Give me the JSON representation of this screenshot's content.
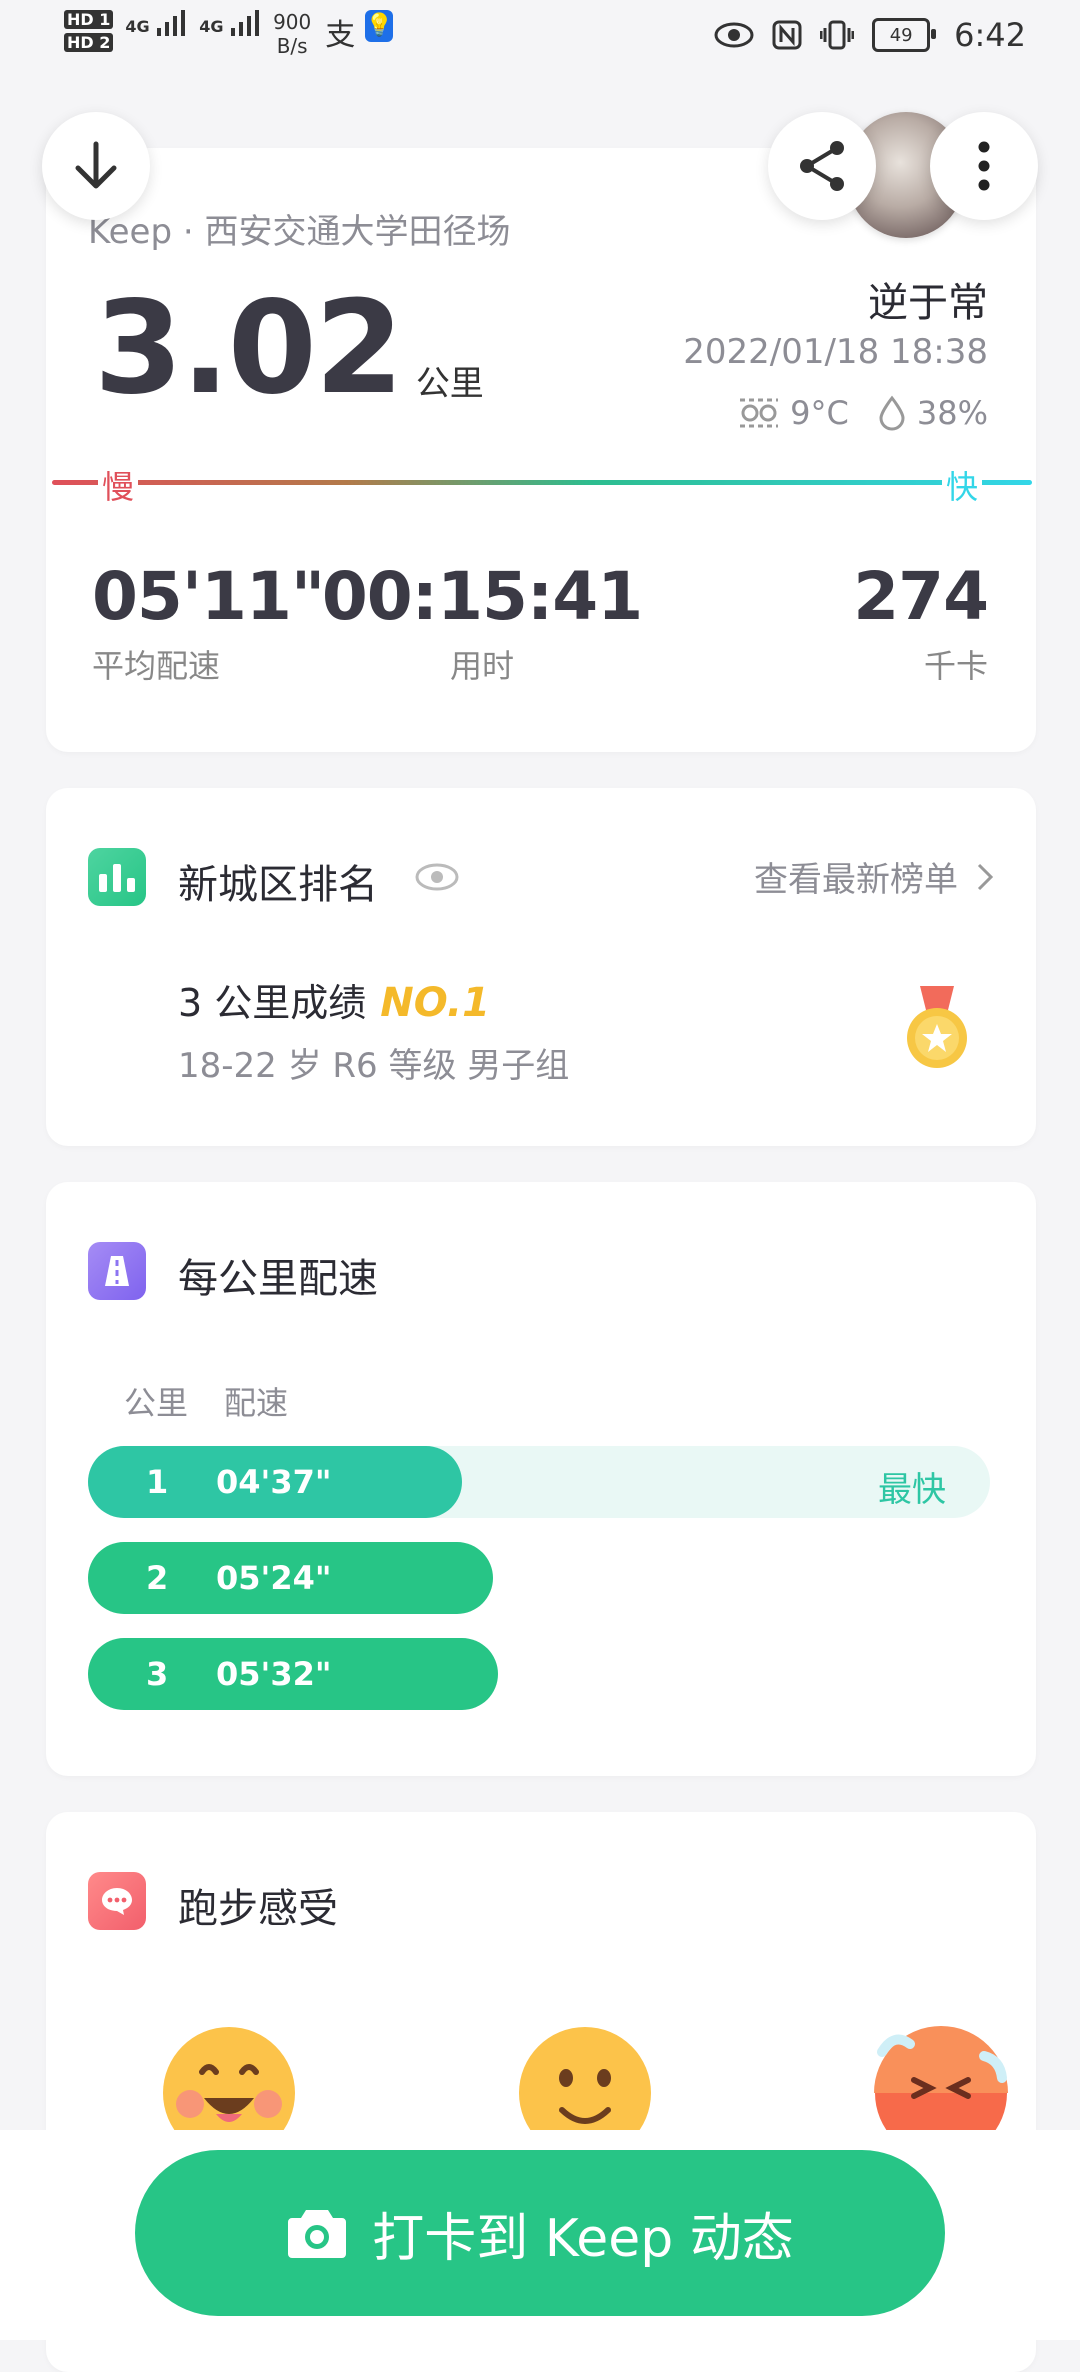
{
  "status_bar": {
    "sim1": "HD 1",
    "sim2": "HD 2",
    "network1": "4G",
    "network2": "4G",
    "speed_value": "900",
    "speed_unit": "B/s",
    "battery": "49",
    "time": "6:42"
  },
  "summary": {
    "source": "Keep · 西安交通大学田径场",
    "distance": "3.02",
    "distance_unit": "公里",
    "user_name": "逆于常",
    "datetime": "2022/01/18 18:38",
    "temperature": "9°C",
    "humidity": "38%",
    "slow_label": "慢",
    "fast_label": "快",
    "stats": [
      {
        "value": "05'11\"",
        "label": "平均配速"
      },
      {
        "value": "00:15:41",
        "label": "用时"
      },
      {
        "value": "274",
        "label": "千卡"
      }
    ]
  },
  "ranking": {
    "title": "新城区排名",
    "link": "查看最新榜单",
    "result_prefix": "3 公里成绩",
    "rank": "NO.1",
    "group": "18-22 岁 R6 等级 男子组"
  },
  "pace": {
    "title": "每公里配速",
    "col_km": "公里",
    "col_pace": "配速",
    "fastest_label": "最快",
    "rows": [
      {
        "km": "1",
        "pace": "04'37\"",
        "fraction": 0.415,
        "color": "#2ec6a4",
        "fastest": true
      },
      {
        "km": "2",
        "pace": "05'24\"",
        "fraction": 0.449,
        "color": "#27c586"
      },
      {
        "km": "3",
        "pace": "05'32\"",
        "fraction": 0.455,
        "color": "#27c586"
      }
    ]
  },
  "feeling": {
    "title": "跑步感受"
  },
  "cta": {
    "label": "打卡到 Keep 动态"
  },
  "colors": {
    "accent_green": "#27c586",
    "teal": "#2ec6a4",
    "slow_red": "#e0505a",
    "fast_cyan": "#33d6e8",
    "rank_gold": "#f4b92a"
  }
}
